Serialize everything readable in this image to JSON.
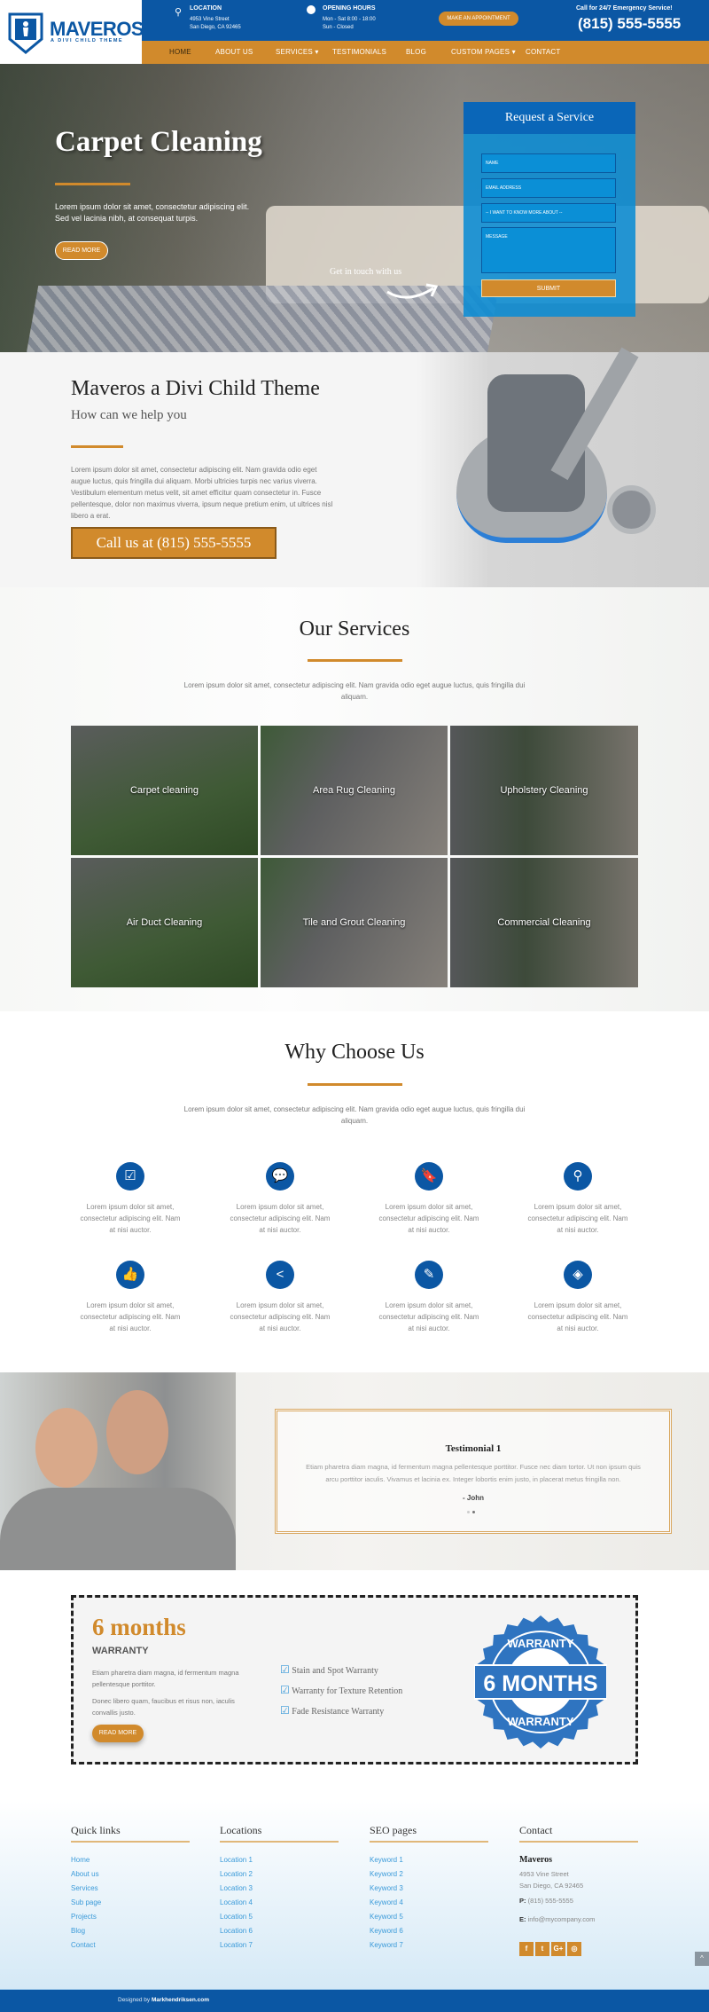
{
  "brand": {
    "name": "MAVEROS",
    "tagline": "A DIVI CHILD THEME"
  },
  "topbar": {
    "location": {
      "label": "LOCATION",
      "line1": "4953 Vine Street",
      "line2": "San Diego, CA 92465"
    },
    "hours": {
      "label": "OPENING HOURS",
      "line1": "Mon - Sat 8:00 - 18:00",
      "line2": "Sun - Closed"
    },
    "appointment": "MAKE AN APPOINTMENT",
    "emergency": "Call for 24/7 Emergency Service!",
    "phone": "(815) 555-5555"
  },
  "nav": [
    "HOME",
    "ABOUT US",
    "SERVICES",
    "TESTIMONIALS",
    "BLOG",
    "CUSTOM PAGES",
    "CONTACT"
  ],
  "hero": {
    "title": "Carpet Cleaning",
    "text": "Lorem ipsum dolor sit amet, consectetur adipiscing elit. Sed vel lacinia nibh, at consequat turpis.",
    "button": "READ MORE",
    "cta": "Get in touch with us"
  },
  "form": {
    "title": "Request a Service",
    "name": "NAME",
    "email": "EMAIL ADDRESS",
    "select": "-- I WANT TO KNOW MORE ABOUT --",
    "message": "MESSAGE",
    "submit": "SUBMIT"
  },
  "intro": {
    "title": "Maveros a Divi Child Theme",
    "subtitle": "How can we help you",
    "text": "Lorem ipsum dolor sit amet, consectetur adipiscing elit. Nam gravida odio eget augue luctus, quis fringilla dui aliquam. Morbi ultricies turpis nec varius viverra. Vestibulum elementum metus velit, sit amet efficitur quam consectetur in. Fusce pellentesque, dolor non maximus viverra, ipsum neque pretium enim, ut ultrices nisl libero a erat.",
    "button": "Call us at (815) 555-5555"
  },
  "services": {
    "title": "Our Services",
    "text": "Lorem ipsum dolor sit amet, consectetur adipiscing elit. Nam gravida odio eget augue luctus, quis fringilla dui aliquam.",
    "items": [
      "Carpet cleaning",
      "Area Rug Cleaning",
      "Upholstery Cleaning",
      "Air Duct Cleaning",
      "Tile and Grout Cleaning",
      "Commercial Cleaning"
    ]
  },
  "why": {
    "title": "Why Choose Us",
    "text": "Lorem ipsum dolor sit amet, consectetur adipiscing elit. Nam gravida odio eget augue luctus, quis fringilla dui aliquam.",
    "features": [
      {
        "icon": "checkbox-icon",
        "text": "Lorem ipsum dolor sit amet, consectetur adipiscing elit. Nam at nisi auctor."
      },
      {
        "icon": "chat-icon",
        "text": "Lorem ipsum dolor sit amet, consectetur adipiscing elit. Nam at nisi auctor."
      },
      {
        "icon": "bookmark-icon",
        "text": "Lorem ipsum dolor sit amet, consectetur adipiscing elit. Nam at nisi auctor."
      },
      {
        "icon": "map-pin-icon",
        "text": "Lorem ipsum dolor sit amet, consectetur adipiscing elit. Nam at nisi auctor."
      },
      {
        "icon": "thumbs-up-icon",
        "text": "Lorem ipsum dolor sit amet, consectetur adipiscing elit. Nam at nisi auctor."
      },
      {
        "icon": "share-icon",
        "text": "Lorem ipsum dolor sit amet, consectetur adipiscing elit. Nam at nisi auctor."
      },
      {
        "icon": "edit-icon",
        "text": "Lorem ipsum dolor sit amet, consectetur adipiscing elit. Nam at nisi auctor."
      },
      {
        "icon": "shield-icon",
        "text": "Lorem ipsum dolor sit amet, consectetur adipiscing elit. Nam at nisi auctor."
      }
    ]
  },
  "testimonial": {
    "title": "Testimonial 1",
    "text": "Etiam pharetra diam magna, id fermentum magna pellentesque porttitor. Fusce nec diam tortor. Ut non ipsum quis arcu porttitor iaculis. Vivamus et lacinia ex. Integer lobortis enim justo, in placerat metus fringilla non.",
    "author": "- John"
  },
  "warranty": {
    "big": "6 months",
    "label": "WARRANTY",
    "p1": "Etiam pharetra diam magna, id fermentum magna pellentesque porttitor.",
    "p2": "Donec libero quam, faucibus et risus non, iaculis convallis justo.",
    "button": "READ MORE",
    "list": [
      "Stain and Spot Warranty",
      "Warranty for Texture Retention",
      "Fade Resistance Warranty"
    ],
    "badge": {
      "top": "WARRANTY",
      "middle": "6 MONTHS",
      "bottom": "WARRANTY"
    }
  },
  "footer": {
    "quick": {
      "title": "Quick links",
      "links": [
        "Home",
        "About us",
        "Services",
        "Sub page",
        "Projects",
        "Blog",
        "Contact"
      ]
    },
    "locations": {
      "title": "Locations",
      "links": [
        "Location 1",
        "Location 2",
        "Location 3",
        "Location 4",
        "Location 5",
        "Location 6",
        "Location 7"
      ]
    },
    "seo": {
      "title": "SEO pages",
      "links": [
        "Keyword 1",
        "Keyword 2",
        "Keyword 3",
        "Keyword 4",
        "Keyword 5",
        "Keyword 6",
        "Keyword 7"
      ]
    },
    "contact": {
      "title": "Contact",
      "name": "Maveros",
      "line1": "4953 Vine Street",
      "line2": "San Diego, CA 92465",
      "phone_label": "P:",
      "phone": "(815) 555-5555",
      "email_label": "E:",
      "email": "info@mycompany.com"
    },
    "social": [
      {
        "icon": "facebook-icon",
        "glyph": "f"
      },
      {
        "icon": "twitter-icon",
        "glyph": "t"
      },
      {
        "icon": "google-plus-icon",
        "glyph": "G+"
      },
      {
        "icon": "instagram-icon",
        "glyph": "◎"
      }
    ],
    "designed_by": "Designed by",
    "designer": "Markhendriksen.com"
  },
  "colors": {
    "blue": "#0b57a4",
    "orange": "#d18a2c",
    "form_blue": "#0b8fd6"
  }
}
